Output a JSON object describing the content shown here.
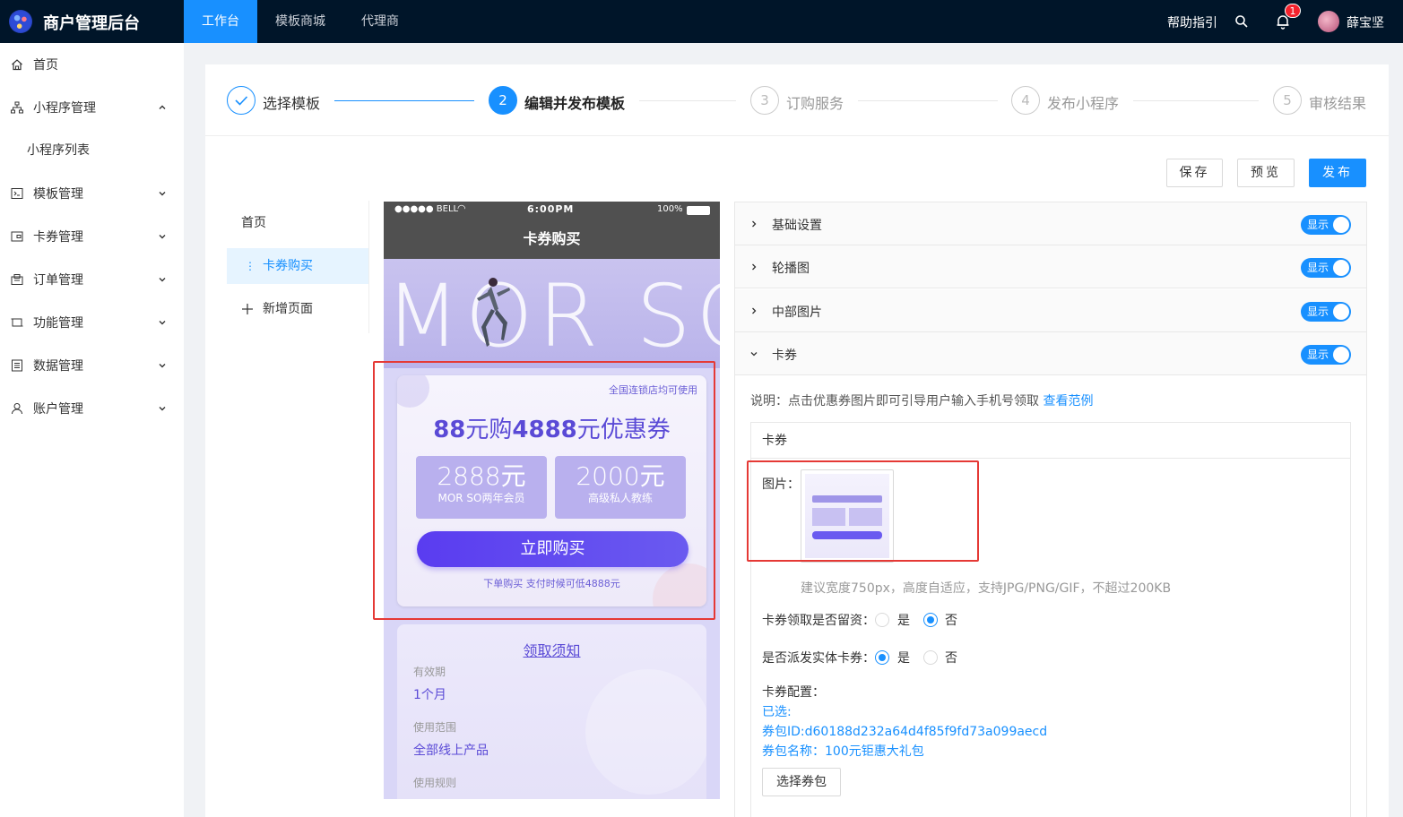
{
  "header": {
    "app_title": "商户管理后台",
    "nav": [
      {
        "label": "工作台",
        "active": true
      },
      {
        "label": "模板商城",
        "active": false
      },
      {
        "label": "代理商",
        "active": false
      }
    ],
    "help": "帮助指引",
    "notification_count": "1",
    "username": "薛宝坚"
  },
  "sidebar": {
    "items": [
      {
        "label": "首页",
        "icon": "home-icon"
      },
      {
        "label": "小程序管理",
        "icon": "sitemap-icon",
        "expanded": true
      },
      {
        "label": "模板管理",
        "icon": "template-icon"
      },
      {
        "label": "卡券管理",
        "icon": "wallet-icon"
      },
      {
        "label": "订单管理",
        "icon": "order-icon"
      },
      {
        "label": "功能管理",
        "icon": "function-icon"
      },
      {
        "label": "数据管理",
        "icon": "data-icon"
      },
      {
        "label": "账户管理",
        "icon": "user-icon"
      }
    ],
    "sub_item": "小程序列表"
  },
  "steps": [
    {
      "num": "1",
      "label": "选择模板",
      "state": "done"
    },
    {
      "num": "2",
      "label": "编辑并发布模板",
      "state": "active"
    },
    {
      "num": "3",
      "label": "订购服务",
      "state": "todo"
    },
    {
      "num": "4",
      "label": "发布小程序",
      "state": "todo"
    },
    {
      "num": "5",
      "label": "审核结果",
      "state": "todo"
    }
  ],
  "actions": {
    "save": "保存",
    "preview": "预览",
    "publish": "发布"
  },
  "pages": {
    "home": "首页",
    "active": "卡券购买",
    "add": "新增页面"
  },
  "phone": {
    "carrier": "●●●●● BELL",
    "time": "6:00PM",
    "battery": "100%",
    "nav_title": "卡券购买",
    "hero_text": "MOR SO",
    "coupon": {
      "note": "全国连锁店均可使用",
      "title_a": "88",
      "title_b": "元购",
      "title_c": "4888",
      "title_d": "元优惠券",
      "left_big": "2888元",
      "left_small": "MOR SO两年会员",
      "right_big": "2000元",
      "right_small": "高级私人教练",
      "buy": "立即购买",
      "sub": "下单购买 支付时候可低4888元"
    },
    "notice": {
      "title": "领取须知",
      "validity_label": "有效期",
      "validity_value": "1个月",
      "scope_label": "使用范围",
      "scope_value": "全部线上产品",
      "rule_label": "使用规则"
    }
  },
  "config": {
    "sections": [
      {
        "title": "基础设置",
        "toggle": "显示",
        "expanded": false
      },
      {
        "title": "轮播图",
        "toggle": "显示",
        "expanded": false
      },
      {
        "title": "中部图片",
        "toggle": "显示",
        "expanded": false
      },
      {
        "title": "卡券",
        "toggle": "显示",
        "expanded": true
      }
    ],
    "desc": "说明：点击优惠券图片即可引导用户输入手机号领取",
    "desc_link": "查看范例",
    "card_title": "卡券",
    "image_label": "图片：",
    "hint": "建议宽度750px，高度自适应，支持JPG/PNG/GIF，不超过200KB",
    "q1_label": "卡券领取是否留资：",
    "q2_label": "是否派发实体卡券：",
    "yes": "是",
    "no": "否",
    "q1_value": "no",
    "q2_value": "yes",
    "config_label": "卡券配置：",
    "selected": "已选:",
    "package_id": "券包ID:d60188d232a64d4f85f9fd73a099aecd",
    "package_name": "券包名称：100元钜惠大礼包",
    "select_btn": "选择券包"
  },
  "colors": {
    "primary": "#1890ff",
    "header_bg": "#001529",
    "coupon_purple": "#5a4ad6",
    "highlight_red": "#e53935"
  }
}
